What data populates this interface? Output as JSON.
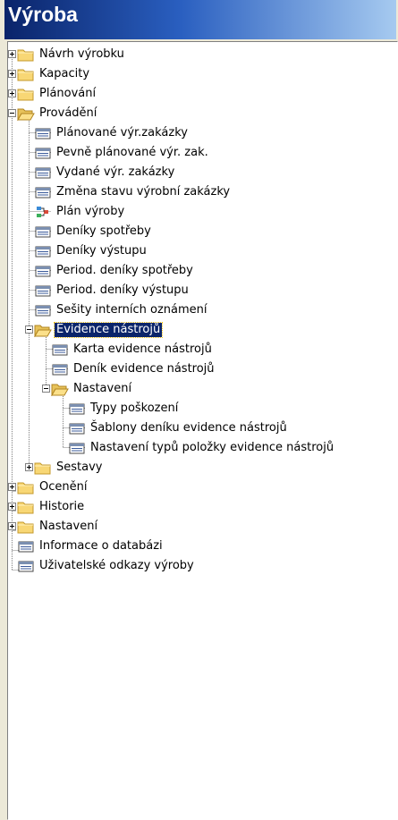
{
  "window": {
    "title": "Výroba"
  },
  "tree": {
    "items": [
      {
        "label": "Návrh výrobku",
        "icon": "folder-icon"
      },
      {
        "label": "Kapacity",
        "icon": "folder-icon"
      },
      {
        "label": "Plánování",
        "icon": "folder-icon"
      },
      {
        "label": "Provádění",
        "icon": "folder-open-icon"
      },
      {
        "label": "Plánované výr.zakázky",
        "icon": "list-icon"
      },
      {
        "label": "Pevně plánované výr. zak.",
        "icon": "list-icon"
      },
      {
        "label": "Vydané výr. zakázky",
        "icon": "list-icon"
      },
      {
        "label": "Změna stavu výrobní zakázky",
        "icon": "list-icon"
      },
      {
        "label": "Plán výroby",
        "icon": "plan-icon"
      },
      {
        "label": "Deníky spotřeby",
        "icon": "list-icon"
      },
      {
        "label": "Deníky výstupu",
        "icon": "list-icon"
      },
      {
        "label": "Period. deníky spotřeby",
        "icon": "list-icon"
      },
      {
        "label": "Period. deníky výstupu",
        "icon": "list-icon"
      },
      {
        "label": "Sešity interních oznámení",
        "icon": "list-icon"
      },
      {
        "label": "Evidence nástrojů",
        "icon": "folder-open-icon"
      },
      {
        "label": "Karta evidence nástrojů",
        "icon": "list-icon"
      },
      {
        "label": "Deník evidence nástrojů",
        "icon": "list-icon"
      },
      {
        "label": "Nastavení",
        "icon": "folder-open-icon"
      },
      {
        "label": "Typy poškození",
        "icon": "list-icon"
      },
      {
        "label": "Šablony deníku evidence nástrojů",
        "icon": "list-icon"
      },
      {
        "label": "Nastavení typů položky evidence nástrojů",
        "icon": "list-icon"
      },
      {
        "label": "Sestavy",
        "icon": "folder-icon"
      },
      {
        "label": "Ocenění",
        "icon": "folder-icon"
      },
      {
        "label": "Historie",
        "icon": "folder-icon"
      },
      {
        "label": "Nastavení",
        "icon": "folder-icon"
      },
      {
        "label": "Informace o databázi",
        "icon": "list-icon"
      },
      {
        "label": "Uživatelské odkazy výroby",
        "icon": "list-icon"
      }
    ]
  }
}
